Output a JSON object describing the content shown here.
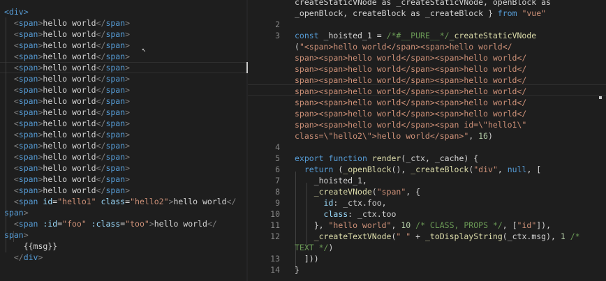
{
  "left_editor": {
    "lines": [
      [
        [
          "tag",
          "<div>"
        ]
      ],
      [
        [
          "punc",
          "  <"
        ],
        [
          "tag",
          "span"
        ],
        [
          "punc",
          ">"
        ],
        [
          "txt",
          "hello world"
        ],
        [
          "punc",
          "</"
        ],
        [
          "tag",
          "span"
        ],
        [
          "punc",
          ">"
        ]
      ],
      [
        [
          "punc",
          "  <"
        ],
        [
          "tag",
          "span"
        ],
        [
          "punc",
          ">"
        ],
        [
          "txt",
          "hello world"
        ],
        [
          "punc",
          "</"
        ],
        [
          "tag",
          "span"
        ],
        [
          "punc",
          ">"
        ]
      ],
      [
        [
          "punc",
          "  <"
        ],
        [
          "tag",
          "span"
        ],
        [
          "punc",
          ">"
        ],
        [
          "txt",
          "hello world"
        ],
        [
          "punc",
          "</"
        ],
        [
          "tag",
          "span"
        ],
        [
          "punc",
          ">"
        ]
      ],
      [
        [
          "punc",
          "  <"
        ],
        [
          "tag",
          "span"
        ],
        [
          "punc",
          ">"
        ],
        [
          "txt",
          "hello world"
        ],
        [
          "punc",
          "</"
        ],
        [
          "tag",
          "span"
        ],
        [
          "punc",
          ">"
        ]
      ],
      [
        [
          "punc",
          "  <"
        ],
        [
          "tag",
          "span"
        ],
        [
          "punc",
          ">"
        ],
        [
          "txt",
          "hello world"
        ],
        [
          "punc",
          "</"
        ],
        [
          "tag",
          "span"
        ],
        [
          "punc",
          ">"
        ]
      ],
      [
        [
          "punc",
          "  <"
        ],
        [
          "tag",
          "span"
        ],
        [
          "punc",
          ">"
        ],
        [
          "txt",
          "hello world"
        ],
        [
          "punc",
          "</"
        ],
        [
          "tag",
          "span"
        ],
        [
          "punc",
          ">"
        ]
      ],
      [
        [
          "punc",
          "  <"
        ],
        [
          "tag",
          "span"
        ],
        [
          "punc",
          ">"
        ],
        [
          "txt",
          "hello world"
        ],
        [
          "punc",
          "</"
        ],
        [
          "tag",
          "span"
        ],
        [
          "punc",
          ">"
        ]
      ],
      [
        [
          "punc",
          "  <"
        ],
        [
          "tag",
          "span"
        ],
        [
          "punc",
          ">"
        ],
        [
          "txt",
          "hello world"
        ],
        [
          "punc",
          "</"
        ],
        [
          "tag",
          "span"
        ],
        [
          "punc",
          ">"
        ]
      ],
      [
        [
          "punc",
          "  <"
        ],
        [
          "tag",
          "span"
        ],
        [
          "punc",
          ">"
        ],
        [
          "txt",
          "hello world"
        ],
        [
          "punc",
          "</"
        ],
        [
          "tag",
          "span"
        ],
        [
          "punc",
          ">"
        ]
      ],
      [
        [
          "punc",
          "  <"
        ],
        [
          "tag",
          "span"
        ],
        [
          "punc",
          ">"
        ],
        [
          "txt",
          "hello world"
        ],
        [
          "punc",
          "</"
        ],
        [
          "tag",
          "span"
        ],
        [
          "punc",
          ">"
        ]
      ],
      [
        [
          "punc",
          "  <"
        ],
        [
          "tag",
          "span"
        ],
        [
          "punc",
          ">"
        ],
        [
          "txt",
          "hello world"
        ],
        [
          "punc",
          "</"
        ],
        [
          "tag",
          "span"
        ],
        [
          "punc",
          ">"
        ]
      ],
      [
        [
          "punc",
          "  <"
        ],
        [
          "tag",
          "span"
        ],
        [
          "punc",
          ">"
        ],
        [
          "txt",
          "hello world"
        ],
        [
          "punc",
          "</"
        ],
        [
          "tag",
          "span"
        ],
        [
          "punc",
          ">"
        ]
      ],
      [
        [
          "punc",
          "  <"
        ],
        [
          "tag",
          "span"
        ],
        [
          "punc",
          ">"
        ],
        [
          "txt",
          "hello world"
        ],
        [
          "punc",
          "</"
        ],
        [
          "tag",
          "span"
        ],
        [
          "punc",
          ">"
        ]
      ],
      [
        [
          "punc",
          "  <"
        ],
        [
          "tag",
          "span"
        ],
        [
          "punc",
          ">"
        ],
        [
          "txt",
          "hello world"
        ],
        [
          "punc",
          "</"
        ],
        [
          "tag",
          "span"
        ],
        [
          "punc",
          ">"
        ]
      ],
      [
        [
          "punc",
          "  <"
        ],
        [
          "tag",
          "span"
        ],
        [
          "punc",
          ">"
        ],
        [
          "txt",
          "hello world"
        ],
        [
          "punc",
          "</"
        ],
        [
          "tag",
          "span"
        ],
        [
          "punc",
          ">"
        ]
      ],
      [
        [
          "punc",
          "  <"
        ],
        [
          "tag",
          "span"
        ],
        [
          "punc",
          ">"
        ],
        [
          "txt",
          "hello world"
        ],
        [
          "punc",
          "</"
        ],
        [
          "tag",
          "span"
        ],
        [
          "punc",
          ">"
        ]
      ],
      [
        [
          "punc",
          "  <"
        ],
        [
          "tag",
          "span"
        ],
        [
          "txt",
          " "
        ],
        [
          "attr",
          "id"
        ],
        [
          "txt",
          "="
        ],
        [
          "str",
          "\"hello1\""
        ],
        [
          "txt",
          " "
        ],
        [
          "attr",
          "class"
        ],
        [
          "txt",
          "="
        ],
        [
          "str",
          "\"hello2\""
        ],
        [
          "punc",
          ">"
        ],
        [
          "txt",
          "hello world"
        ],
        [
          "punc",
          "</"
        ]
      ],
      [
        [
          "tag",
          "span"
        ],
        [
          "punc",
          ">"
        ]
      ],
      [
        [
          "punc",
          "  <"
        ],
        [
          "tag",
          "span"
        ],
        [
          "txt",
          " "
        ],
        [
          "attr",
          ":id"
        ],
        [
          "txt",
          "="
        ],
        [
          "str",
          "\"foo\""
        ],
        [
          "txt",
          " "
        ],
        [
          "attr",
          ":class"
        ],
        [
          "txt",
          "="
        ],
        [
          "str",
          "\"too\""
        ],
        [
          "punc",
          ">"
        ],
        [
          "txt",
          "hello world"
        ],
        [
          "punc",
          "</"
        ]
      ],
      [
        [
          "tag",
          "span"
        ],
        [
          "punc",
          ">"
        ]
      ],
      [
        [
          "txt",
          "    {{msg}}"
        ]
      ],
      [
        [
          "punc",
          "  </"
        ],
        [
          "tag",
          "div"
        ],
        [
          "punc",
          ">"
        ]
      ]
    ]
  },
  "right_editor": {
    "lines": [
      {
        "n": "",
        "parts": [
          [
            "txt",
            "createStaticVNode as _createStaticVNode, openBlock as"
          ]
        ]
      },
      {
        "n": "",
        "parts": [
          [
            "txt",
            "_openBlock, createBlock as _createBlock } "
          ],
          [
            "kw",
            "from"
          ],
          [
            "txt",
            " "
          ],
          [
            "str",
            "\"vue\""
          ]
        ]
      },
      {
        "n": "2",
        "parts": []
      },
      {
        "n": "3",
        "parts": [
          [
            "kw",
            "const"
          ],
          [
            "txt",
            " _hoisted_1 = "
          ],
          [
            "cm",
            "/*#__PURE__*/"
          ],
          [
            "fn",
            "_createStaticVNode"
          ]
        ]
      },
      {
        "n": "",
        "parts": [
          [
            "txt",
            "("
          ],
          [
            "str",
            "\"<span>hello world</span><span>hello world</"
          ]
        ]
      },
      {
        "n": "",
        "parts": [
          [
            "str",
            "span><span>hello world</span><span>hello world</"
          ]
        ]
      },
      {
        "n": "",
        "parts": [
          [
            "str",
            "span><span>hello world</span><span>hello world</"
          ]
        ]
      },
      {
        "n": "",
        "parts": [
          [
            "str",
            "span><span>hello world</span><span>hello world</"
          ]
        ]
      },
      {
        "n": "",
        "parts": [
          [
            "str",
            "span><span>hello world</span><span>hello world</"
          ]
        ]
      },
      {
        "n": "",
        "parts": [
          [
            "str",
            "span><span>hello world</span><span>hello world</"
          ]
        ]
      },
      {
        "n": "",
        "parts": [
          [
            "str",
            "span><span>hello world</span><span>hello world</"
          ]
        ]
      },
      {
        "n": "",
        "parts": [
          [
            "str",
            "span><span>hello world</span><span id=\\\"hello1\\\""
          ]
        ]
      },
      {
        "n": "",
        "parts": [
          [
            "str",
            "class=\\\"hello2\\\">hello world</span>\""
          ],
          [
            "txt",
            ", "
          ],
          [
            "num",
            "16"
          ],
          [
            "txt",
            ")"
          ]
        ]
      },
      {
        "n": "4",
        "parts": []
      },
      {
        "n": "5",
        "parts": [
          [
            "kw",
            "export"
          ],
          [
            "txt",
            " "
          ],
          [
            "kw",
            "function"
          ],
          [
            "txt",
            " "
          ],
          [
            "fn",
            "render"
          ],
          [
            "txt",
            "(_ctx, _cache) {"
          ]
        ]
      },
      {
        "n": "6",
        "parts": [
          [
            "txt",
            "  "
          ],
          [
            "kw",
            "return"
          ],
          [
            "txt",
            " ("
          ],
          [
            "fn",
            "_openBlock"
          ],
          [
            "txt",
            "(), "
          ],
          [
            "fn",
            "_createBlock"
          ],
          [
            "txt",
            "("
          ],
          [
            "str",
            "\"div\""
          ],
          [
            "txt",
            ", "
          ],
          [
            "kw",
            "null"
          ],
          [
            "txt",
            ", ["
          ]
        ]
      },
      {
        "n": "7",
        "parts": [
          [
            "txt",
            "    _hoisted_1,"
          ]
        ]
      },
      {
        "n": "8",
        "parts": [
          [
            "txt",
            "    "
          ],
          [
            "fn",
            "_createVNode"
          ],
          [
            "txt",
            "("
          ],
          [
            "str",
            "\"span\""
          ],
          [
            "txt",
            ", {"
          ]
        ]
      },
      {
        "n": "9",
        "parts": [
          [
            "txt",
            "      "
          ],
          [
            "attr",
            "id"
          ],
          [
            "txt",
            ": _ctx.foo,"
          ]
        ]
      },
      {
        "n": "10",
        "parts": [
          [
            "txt",
            "      "
          ],
          [
            "attr",
            "class"
          ],
          [
            "txt",
            ": _ctx.too"
          ]
        ]
      },
      {
        "n": "11",
        "parts": [
          [
            "txt",
            "    }, "
          ],
          [
            "str",
            "\"hello world\""
          ],
          [
            "txt",
            ", "
          ],
          [
            "num",
            "10"
          ],
          [
            "txt",
            " "
          ],
          [
            "cm",
            "/* CLASS, PROPS */"
          ],
          [
            "txt",
            ", ["
          ],
          [
            "str",
            "\"id\""
          ],
          [
            "txt",
            "]),"
          ]
        ]
      },
      {
        "n": "12",
        "parts": [
          [
            "txt",
            "    "
          ],
          [
            "fn",
            "_createTextVNode"
          ],
          [
            "txt",
            "("
          ],
          [
            "str",
            "\" \""
          ],
          [
            "txt",
            " + "
          ],
          [
            "fn",
            "_toDisplayString"
          ],
          [
            "txt",
            "(_ctx.msg), "
          ],
          [
            "num",
            "1"
          ],
          [
            "txt",
            " "
          ],
          [
            "cm",
            "/*"
          ]
        ]
      },
      {
        "n": "",
        "parts": [
          [
            "cm",
            "TEXT */"
          ],
          [
            "txt",
            ")"
          ]
        ]
      },
      {
        "n": "13",
        "parts": [
          [
            "txt",
            "  ]))"
          ]
        ]
      },
      {
        "n": "14",
        "parts": [
          [
            "txt",
            "}"
          ]
        ]
      }
    ]
  }
}
